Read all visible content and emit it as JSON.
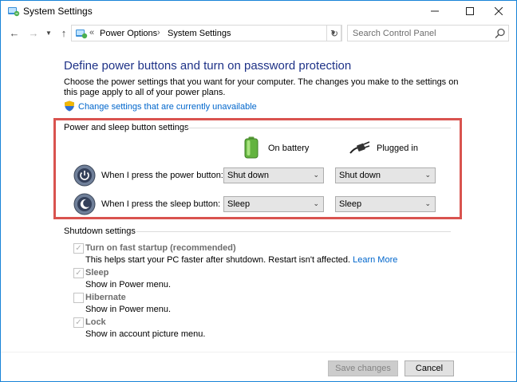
{
  "window": {
    "title": "System Settings"
  },
  "window_controls": {
    "minimize": "—",
    "maximize": "☐",
    "close": "✕"
  },
  "nav": {
    "back": "←",
    "forward": "→",
    "recent": "▼",
    "up": "↑",
    "address_prefix": "«",
    "breadcrumbs": [
      "Power Options",
      "System Settings"
    ],
    "crumb_separator": "›",
    "address_dropdown": "▼",
    "refresh": "↻",
    "search_placeholder": "Search Control Panel"
  },
  "main": {
    "title": "Define power buttons and turn on password protection",
    "intro": "Choose the power settings that you want for your computer. The changes you make to the settings on this page apply to all of your power plans.",
    "change_link": "Change settings that are currently unavailable"
  },
  "power_group": {
    "label": "Power and sleep button settings",
    "columns": {
      "battery": "On battery",
      "plugged": "Plugged in"
    },
    "rows": [
      {
        "label": "When I press the power button:",
        "battery": "Shut down",
        "plugged": "Shut down"
      },
      {
        "label": "When I press the sleep button:",
        "battery": "Sleep",
        "plugged": "Sleep"
      }
    ],
    "dropdown_arrow": "⌄"
  },
  "shutdown_group": {
    "label": "Shutdown settings",
    "items": [
      {
        "label": "Turn on fast startup (recommended)",
        "checked": "✓",
        "desc": "This helps start your PC faster after shutdown. Restart isn't affected.",
        "link": "Learn More"
      },
      {
        "label": "Sleep",
        "checked": "✓",
        "desc": "Show in Power menu."
      },
      {
        "label": "Hibernate",
        "checked": "",
        "desc": "Show in Power menu."
      },
      {
        "label": "Lock",
        "checked": "✓",
        "desc": "Show in account picture menu."
      }
    ]
  },
  "footer": {
    "save": "Save changes",
    "cancel": "Cancel"
  },
  "colors": {
    "accent": "#1e3287",
    "link": "#0066cc",
    "highlight_border": "#d9534f",
    "window_border": "#1883d7"
  }
}
